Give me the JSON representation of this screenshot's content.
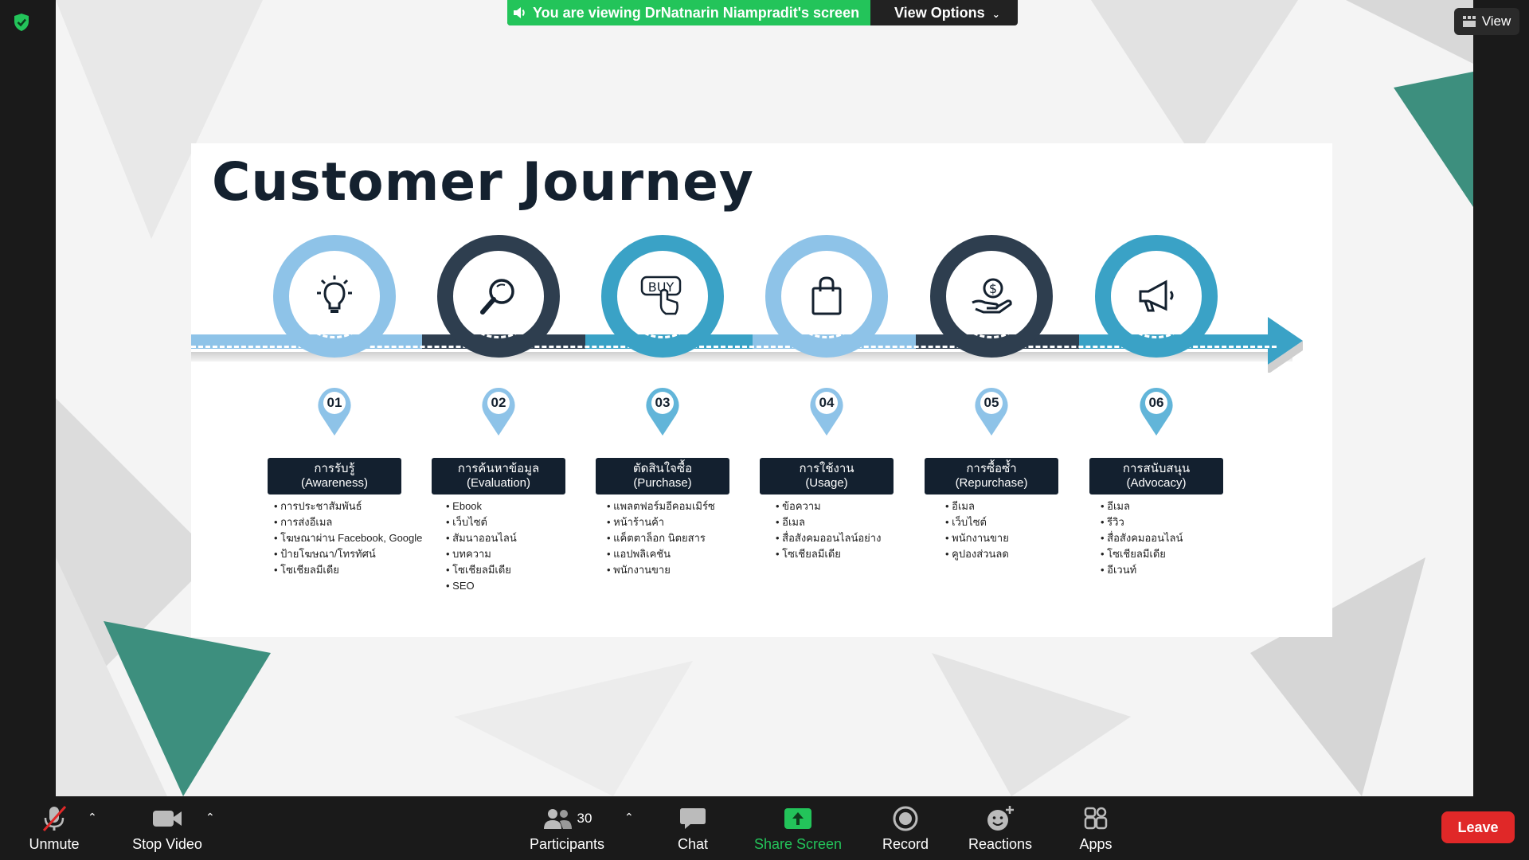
{
  "meeting": {
    "banner_text": "You are viewing DrNatnarin Niampradit's screen",
    "view_options": "View Options",
    "view_button": "View",
    "colors": {
      "banner_green": "#23c45a",
      "leave_red": "#e02828",
      "toolbar_bg": "#1a1a1a"
    }
  },
  "slide": {
    "title": "Customer Journey",
    "colors": {
      "light_blue": "#8ec3e8",
      "dark_navy": "#2e3e4f",
      "teal": "#3aa2c6",
      "label_bg": "#13202f"
    },
    "stages": [
      {
        "num": "01",
        "thai": "การรับรู้",
        "eng": "(Awareness)",
        "icon": "lightbulb-icon",
        "items": [
          "การประชาสัมพันธ์",
          "การส่งอีเมล",
          "โฆษณาผ่าน Facebook, Google",
          "ป้ายโฆษณา/โทรทัศน์",
          "โซเชียลมีเดีย"
        ]
      },
      {
        "num": "02",
        "thai": "การค้นหาข้อมูล",
        "eng": "(Evaluation)",
        "icon": "magnifier-icon",
        "items": [
          "Ebook",
          "เว็บไซต์",
          "สัมนาออนไลน์",
          "บทความ",
          "โซเชียลมีเดีย",
          "SEO"
        ]
      },
      {
        "num": "03",
        "thai": "ตัดสินใจซื้อ",
        "eng": "(Purchase)",
        "icon": "buy-hand-icon",
        "items": [
          "แพลตฟอร์มอีคอมเมิร์ซ",
          "หน้าร้านค้า",
          "แค็ตตาล็อก นิตยสาร",
          "แอปพลิเคชัน",
          "พนักงานขาย"
        ]
      },
      {
        "num": "04",
        "thai": "การใช้งาน",
        "eng": "(Usage)",
        "icon": "shopping-bag-icon",
        "items": [
          "ข้อความ",
          "อีเมล",
          "สื่อสังคมออนไลน์อย่าง",
          "โซเชียลมีเดีย"
        ]
      },
      {
        "num": "05",
        "thai": "การซื้อซ้ำ",
        "eng": "(Repurchase)",
        "icon": "coin-hand-icon",
        "items": [
          "อีเมล",
          "เว็บไซต์",
          "พนักงานขาย",
          "คูปองส่วนลด"
        ]
      },
      {
        "num": "06",
        "thai": "การสนับสนุน",
        "eng": "(Advocacy)",
        "icon": "megaphone-icon",
        "items": [
          "อีเมล",
          "รีวิว",
          "สื่อสังคมออนไลน์",
          "โซเชียลมีเดีย",
          "อีเวนท์"
        ]
      }
    ]
  },
  "toolbar": {
    "unmute": "Unmute",
    "stop_video": "Stop Video",
    "participants": "Participants",
    "participant_count": "30",
    "chat": "Chat",
    "share_screen": "Share Screen",
    "record": "Record",
    "reactions": "Reactions",
    "apps": "Apps",
    "leave": "Leave"
  }
}
